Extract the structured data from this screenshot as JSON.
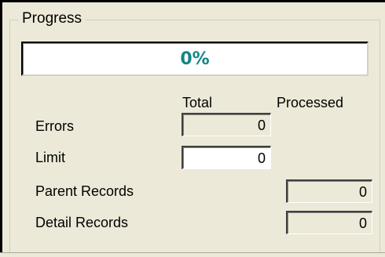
{
  "groupbox": {
    "title": "Progress"
  },
  "progress": {
    "text": "0%",
    "value": 0
  },
  "columns": {
    "total": "Total",
    "processed": "Processed"
  },
  "rows": {
    "errors": {
      "label": "Errors",
      "total": "0"
    },
    "limit": {
      "label": "Limit",
      "total": "0"
    },
    "parent_records": {
      "label": "Parent Records",
      "processed": "0"
    },
    "detail_records": {
      "label": "Detail Records",
      "processed": "0"
    }
  },
  "colors": {
    "progress_text": "#148585",
    "window_bg": "#ece9d8"
  }
}
